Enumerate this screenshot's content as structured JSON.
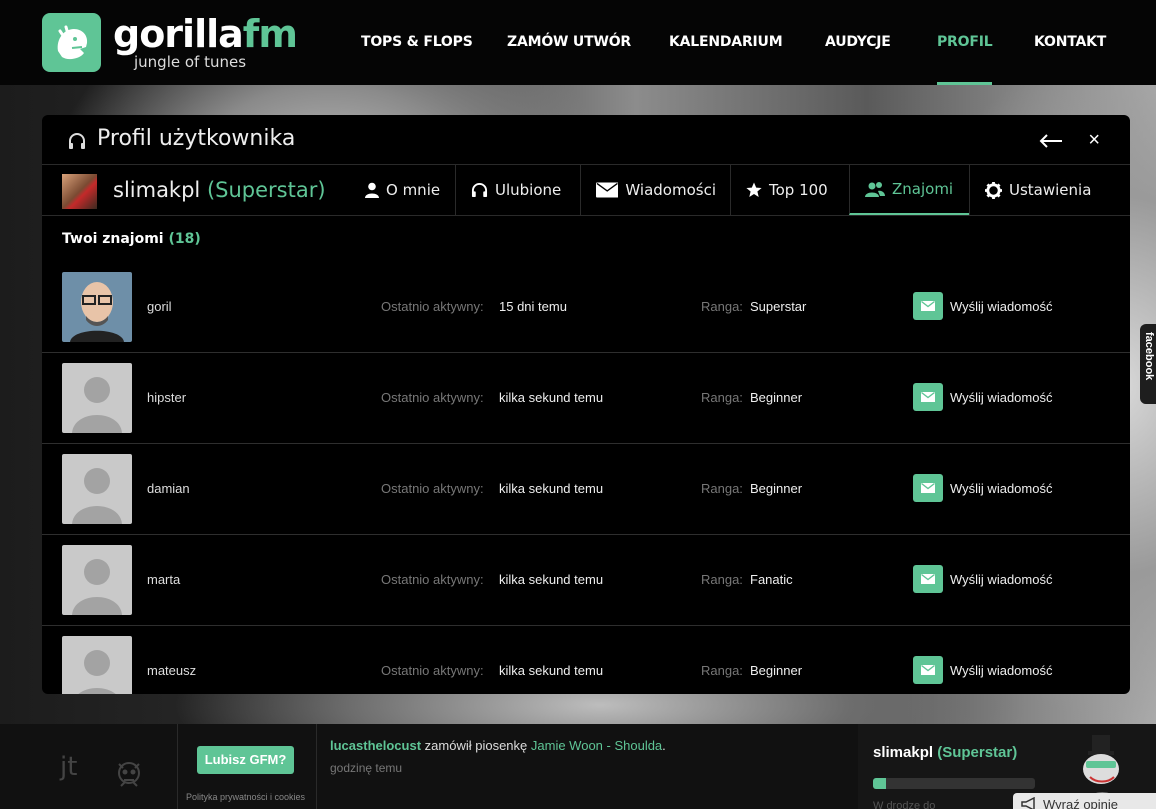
{
  "brand": {
    "name_main": "gorilla",
    "name_accent": "fm",
    "tagline": "jungle of tunes",
    "accent_color": "#5fc596"
  },
  "nav": {
    "items": [
      {
        "label": "TOPS & FLOPS"
      },
      {
        "label": "ZAMÓW UTWÓR"
      },
      {
        "label": "KALENDARIUM"
      },
      {
        "label": "AUDYCJE"
      },
      {
        "label": "PROFIL",
        "active": true
      },
      {
        "label": "KONTAKT"
      }
    ]
  },
  "panel": {
    "title": "Profil użytkownika",
    "user": {
      "name": "slimakpl",
      "rank": "(Superstar)"
    },
    "tabs": [
      {
        "label": "O mnie",
        "icon": "user-icon"
      },
      {
        "label": "Ulubione",
        "icon": "headphones-icon"
      },
      {
        "label": "Wiadomości",
        "icon": "envelope-icon"
      },
      {
        "label": "Top 100",
        "icon": "star-icon"
      },
      {
        "label": "Znajomi",
        "icon": "friends-icon",
        "active": true
      },
      {
        "label": "Ustawienia",
        "icon": "gear-icon"
      }
    ],
    "section_title": "Twoi znajomi",
    "friend_count": "(18)",
    "friends": [
      {
        "name": "goril",
        "active_label": "Ostatnio aktywny:",
        "active": "15 dni temu",
        "rank_label": "Ranga:",
        "rank": "Superstar",
        "action": "Wyślij wiadomość"
      },
      {
        "name": "hipster",
        "active_label": "Ostatnio aktywny:",
        "active": "kilka sekund temu",
        "rank_label": "Ranga:",
        "rank": "Beginner",
        "action": "Wyślij wiadomość"
      },
      {
        "name": "damian",
        "active_label": "Ostatnio aktywny:",
        "active": "kilka sekund temu",
        "rank_label": "Ranga:",
        "rank": "Beginner",
        "action": "Wyślij wiadomość"
      },
      {
        "name": "marta",
        "active_label": "Ostatnio aktywny:",
        "active": "kilka sekund temu",
        "rank_label": "Ranga:",
        "rank": "Fanatic",
        "action": "Wyślij wiadomość"
      },
      {
        "name": "mateusz",
        "active_label": "Ostatnio aktywny:",
        "active": "kilka sekund temu",
        "rank_label": "Ranga:",
        "rank": "Beginner",
        "action": "Wyślij wiadomość"
      }
    ]
  },
  "side_tab": {
    "label": "facebook"
  },
  "footer": {
    "jt_logo": "jt",
    "like_button": "Lubisz GFM?",
    "privacy": "Polityka prywatności i cookies",
    "activity": {
      "user": "lucasthelocust",
      "text": "zamówił piosenkę",
      "song": "Jamie Woon - Shoulda",
      "end": ".",
      "time": "godzinę temu"
    },
    "user": {
      "name": "slimakpl",
      "rank": "(Superstar)",
      "progress": 0.08,
      "sub": "W drodze do"
    },
    "opinion_button": "Wyraź opinię"
  }
}
